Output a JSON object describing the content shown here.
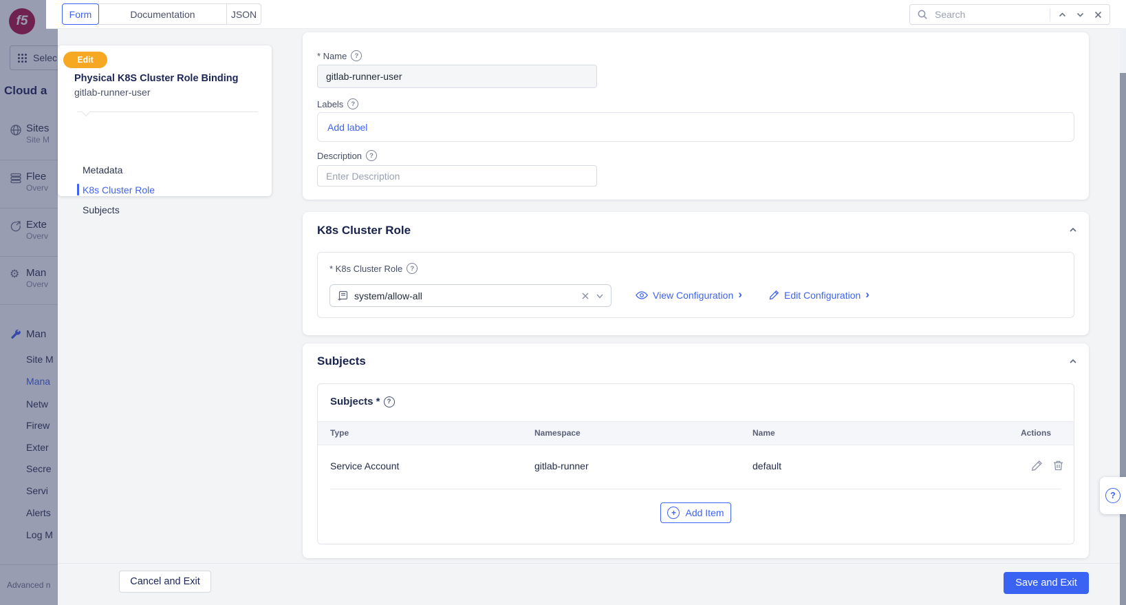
{
  "header": {
    "tabs": [
      {
        "label": "Form"
      },
      {
        "label": "Documentation"
      },
      {
        "label": "JSON"
      }
    ],
    "search": {
      "placeholder": "Search"
    }
  },
  "sidebar": {
    "logo_text": "f5",
    "select_service": "Selec",
    "heading": "Cloud a",
    "groups": [
      {
        "icon": "globe-icon",
        "title": "Sites",
        "subtitle": "Site M"
      },
      {
        "icon": "fleet-icon",
        "title": "Flee",
        "subtitle": "Overv"
      },
      {
        "icon": "compass-icon",
        "title": "Exte",
        "subtitle": "Overv"
      },
      {
        "icon": "gear-icon",
        "title": "Man",
        "subtitle": "Overv"
      },
      {
        "icon": "wrench-icon",
        "title": "Man",
        "subtitle": ""
      }
    ],
    "links": [
      {
        "label": "Site M"
      },
      {
        "label": "Mana",
        "active": true
      },
      {
        "label": "Netw"
      },
      {
        "label": "Firew"
      },
      {
        "label": "Exter"
      },
      {
        "label": "Secre"
      },
      {
        "label": "Servi"
      },
      {
        "label": "Alerts"
      },
      {
        "label": "Log M"
      }
    ],
    "footer": "Advanced n"
  },
  "panel": {
    "badge": "Edit",
    "title": "Physical K8S Cluster Role Binding",
    "subtitle": "gitlab-runner-user",
    "nav": [
      {
        "label": "Metadata"
      },
      {
        "label": "K8s Cluster Role",
        "active": true
      },
      {
        "label": "Subjects"
      }
    ]
  },
  "form": {
    "metadata": {
      "name_label": "* Name",
      "name_value": "gitlab-runner-user",
      "labels_label": "Labels",
      "add_label": "Add label",
      "description_label": "Description",
      "description_placeholder": "Enter Description"
    },
    "cluster_role": {
      "heading": "K8s Cluster Role",
      "field_label": "* K8s Cluster Role",
      "selected": "system/allow-all",
      "view_link": "View Configuration",
      "edit_link": "Edit Configuration",
      "chevron": "›"
    },
    "subjects": {
      "heading": "Subjects",
      "inner_label": "Subjects *",
      "columns": [
        "Type",
        "Namespace",
        "Name",
        "Actions"
      ],
      "rows": [
        {
          "type": "Service Account",
          "namespace": "gitlab-runner",
          "name": "default"
        }
      ],
      "add_item": "Add Item"
    },
    "footer": {
      "cancel": "Cancel and Exit",
      "save": "Save and Exit"
    }
  },
  "colors": {
    "accent": "#3e63f2",
    "badge_orange": "#f7a823",
    "navy": "#1c2655",
    "page_bg": "#f2f4f6",
    "logo_red": "#b01440",
    "dim_overlay": "rgba(42,50,94,0.48)"
  }
}
